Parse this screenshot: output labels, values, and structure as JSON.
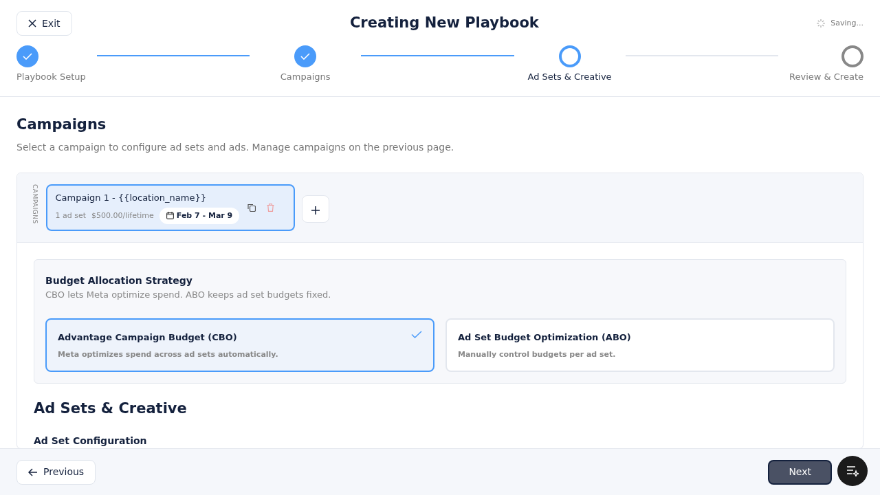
{
  "header": {
    "exit_label": "Exit",
    "title": "Creating New Playbook",
    "saving_text": "Saving..."
  },
  "steps": [
    {
      "label": "Playbook Setup",
      "completed": true,
      "selected": false
    },
    {
      "label": "Campaigns",
      "completed": true,
      "selected": false
    },
    {
      "label": "Ad Sets & Creative",
      "completed": false,
      "selected": true
    },
    {
      "label": "Review & Create",
      "completed": false,
      "selected": false
    }
  ],
  "campaigns_section": {
    "title": "Campaigns",
    "subtitle": "Select a campaign to configure ad sets and ads. Manage campaigns on the previous page.",
    "rail_label": "CAMPAIGNS",
    "campaigns": [
      {
        "name": "Campaign 1 - {{location_name}}",
        "ad_sets": "1 ad set",
        "budget": "$500.00/lifetime",
        "dates": "Feb 7 - Mar 9",
        "selected": true
      }
    ]
  },
  "budget_strategy": {
    "title": "Budget Allocation Strategy",
    "subtitle": "CBO lets Meta optimize spend. ABO keeps ad set budgets fixed.",
    "options": [
      {
        "title": "Advantage Campaign Budget (CBO)",
        "description": "Meta optimizes spend across ad sets automatically.",
        "selected": true
      },
      {
        "title": "Ad Set Budget Optimization (ABO)",
        "description": "Manually control budgets per ad set.",
        "selected": false
      }
    ]
  },
  "ad_sets_section": {
    "title": "Ad Sets & Creative",
    "subtitle": "Ad Set Configuration"
  },
  "footer": {
    "previous_label": "Previous",
    "next_label": "Next"
  }
}
